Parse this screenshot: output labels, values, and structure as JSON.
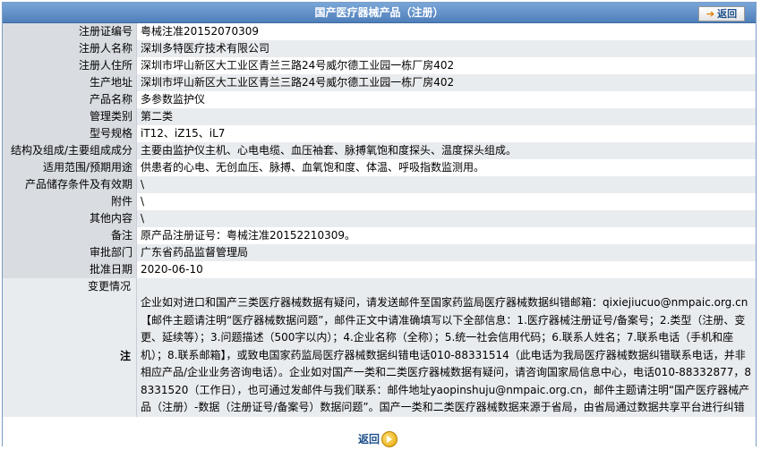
{
  "header": {
    "title": "国产医疗器械产品（注册）",
    "back_label": "返回"
  },
  "rows": [
    {
      "label": "注册证编号",
      "value": "粤械注准20152070309"
    },
    {
      "label": "注册人名称",
      "value": "深圳多特医疗技术有限公司"
    },
    {
      "label": "注册人住所",
      "value": "深圳市坪山新区大工业区青兰三路24号威尔德工业园一栋厂房402"
    },
    {
      "label": "生产地址",
      "value": "深圳市坪山新区大工业区青兰三路24号威尔德工业园一栋厂房402"
    },
    {
      "label": "产品名称",
      "value": "多参数监护仪"
    },
    {
      "label": "管理类别",
      "value": "第二类"
    },
    {
      "label": "型号规格",
      "value": "iT12、iZ15、iL7"
    },
    {
      "label": "结构及组成/主要组成成分",
      "value": "主要由监护仪主机、心电电缆、血压袖套、脉搏氧饱和度探头、温度探头组成。"
    },
    {
      "label": "适用范围/预期用途",
      "value": "供患者的心电、无创血压、脉搏、血氧饱和度、体温、呼吸指数监测用。"
    },
    {
      "label": "产品储存条件及有效期",
      "value": "\\"
    },
    {
      "label": "附件",
      "value": "\\"
    },
    {
      "label": "其他内容",
      "value": "\\"
    },
    {
      "label": "备注",
      "value": "原产品注册证号：粤械注准20152210309。"
    },
    {
      "label": "审批部门",
      "value": "广东省药品监督管理局"
    },
    {
      "label": "批准日期",
      "value": "2020-06-10"
    },
    {
      "label": "有效期至",
      "value": "2025-06-09"
    }
  ],
  "change_label": "变更情况",
  "note": {
    "label": "注",
    "text": "企业如对进口和国产三类医疗器械数据有疑问，请发送邮件至国家药监局医疗器械数据纠错邮箱：qixiejiucuo@nmpaic.org.cn【邮件主题请注明“医疗器械数据问题”，邮件正文中请准确填写以下全部信息：1.医疗器械注册证号/备案号；2.类型（注册、变更、延续等）；3.问题描述（500字以内）；4.企业名称（全称）；5.统一社会信用代码；6.联系人姓名；7.联系电话（手机和座机）；8.联系邮箱】，或致电国家药监局医疗器械数据纠错电话010-88331514（此电话为我局医疗器械数据纠错联系电话，并非相应产品/企业业务咨询电话）。企业如对国产一类和二类医疗器械数据有疑问，请咨询国家局信息中心，电话010-88332877，88331520（工作日），也可通过发邮件与我们联系：邮件地址yaopinshuju@nmpaic.org.cn，邮件主题请注明“国产医疗器械产品（注册）-数据（注册证号/备案号）数据问题”。国产一类和二类医疗器械数据来源于省局，由省局通过数据共享平台进行纠错和维护。"
  },
  "footer": {
    "back_label": "返回"
  }
}
